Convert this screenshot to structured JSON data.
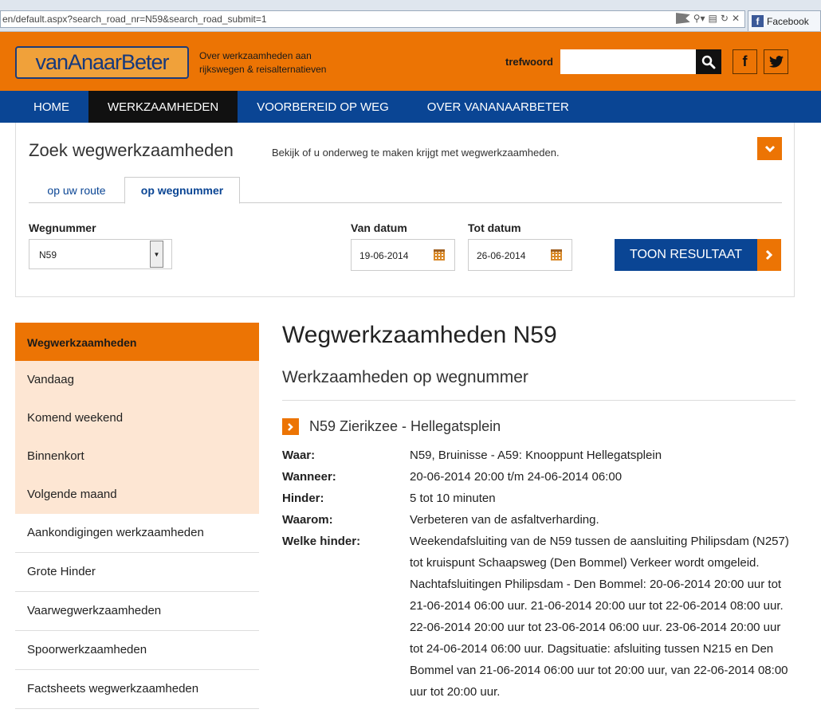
{
  "browser": {
    "url": "en/default.aspx?search_road_nr=N59&search_road_submit=1",
    "tab_label": "Facebook",
    "tab_logo": "f"
  },
  "header": {
    "logo_text": "vanAnaarBeter",
    "tagline": "Over werkzaamheden aan rijkswegen & reisalternatieven",
    "search_label": "trefwoord",
    "search_value": "",
    "facebook_glyph": "f",
    "twitter_glyph": "🐦",
    "accent_color": "#ec7404",
    "brand_color": "#0a4594"
  },
  "nav": {
    "items": [
      {
        "label": "HOME"
      },
      {
        "label": "WERKZAAMHEDEN"
      },
      {
        "label": "VOORBEREID OP WEG"
      },
      {
        "label": "OVER VANANAARBETER"
      }
    ],
    "active_index": 1
  },
  "search_panel": {
    "title": "Zoek wegwerkzaamheden",
    "subtitle": "Bekijk of u onderweg te maken krijgt met wegwerkzaamheden.",
    "tabs": [
      {
        "label": "op uw route"
      },
      {
        "label": "op wegnummer"
      }
    ],
    "wegnummer_label": "Wegnummer",
    "wegnummer_value": "N59",
    "van_label": "Van datum",
    "van_value": "19-06-2014",
    "tot_label": "Tot datum",
    "tot_value": "26-06-2014",
    "submit_label": "TOON RESULTAAT"
  },
  "sidebar": {
    "heading": "Wegwerkzaamheden",
    "sub_items": [
      {
        "label": "Vandaag"
      },
      {
        "label": "Komend weekend"
      },
      {
        "label": "Binnenkort"
      },
      {
        "label": "Volgende maand"
      }
    ],
    "items": [
      {
        "label": "Aankondigingen werkzaamheden"
      },
      {
        "label": "Grote Hinder"
      },
      {
        "label": "Vaarwegwerkzaamheden"
      },
      {
        "label": "Spoorwerkzaamheden"
      },
      {
        "label": "Factsheets wegwerkzaamheden"
      }
    ]
  },
  "main": {
    "title": "Wegwerkzaamheden N59",
    "subtitle": "Werkzaamheden op wegnummer",
    "item_title": "N59 Zierikzee - Hellegatsplein",
    "details": {
      "waar_label": "Waar:",
      "waar_value": "N59, Bruinisse - A59: Knooppunt Hellegatsplein",
      "wanneer_label": "Wanneer:",
      "wanneer_value": "20-06-2014 20:00 t/m 24-06-2014 06:00",
      "hinder_label": "Hinder:",
      "hinder_value": "5 tot 10 minuten",
      "waarom_label": "Waarom:",
      "waarom_value": "Verbeteren van de asfaltverharding.",
      "welke_label": "Welke hinder:",
      "welke_value": "Weekendafsluiting van de N59 tussen de aansluiting Philipsdam (N257) tot kruispunt Schaapsweg (Den Bommel) Verkeer wordt omgeleid. Nachtafsluitingen Philipsdam - Den Bommel: 20-06-2014 20:00 uur tot 21-06-2014 06:00 uur. 21-06-2014 20:00 uur tot 22-06-2014 08:00 uur. 22-06-2014 20:00 uur tot 23-06-2014 06:00 uur. 23-06-2014 20:00 uur tot 24-06-2014 06:00 uur. Dagsituatie: afsluiting tussen N215 en Den Bommel van 21-06-2014 06:00 uur tot 20:00 uur, van 22-06-2014 08:00 uur tot 20:00 uur."
    }
  }
}
